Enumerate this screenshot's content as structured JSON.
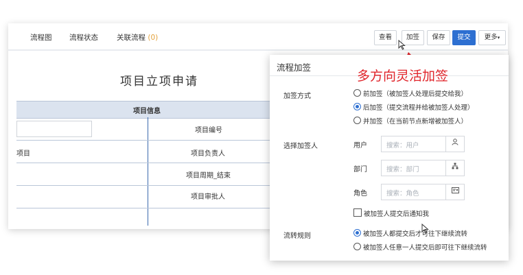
{
  "toolbar": {
    "tabs": [
      "流程图",
      "流程状态",
      "关联流程"
    ],
    "related_count": "(0)",
    "buttons": {
      "view": "查看",
      "add_sign": "加签",
      "save": "保存",
      "submit": "提交",
      "more": "更多"
    }
  },
  "form": {
    "title": "项目立项申请",
    "section": "项目信息",
    "rows": [
      {
        "left": "",
        "right": "项目编号"
      },
      {
        "left": "项目",
        "right": "项目负责人"
      },
      {
        "left": "",
        "right": "项目周期_结束"
      },
      {
        "left": "",
        "right": "项目审批人"
      }
    ]
  },
  "dialog": {
    "title": "流程加签",
    "method_label": "加签方式",
    "method_options": [
      "前加签（被加签人处理后提交给我）",
      "后加签（提交流程并给被加签人处理）",
      "并加签（在当前节点新增被加签人）"
    ],
    "method_selected": 1,
    "select_label": "选择加签人",
    "fields": [
      {
        "label": "用户",
        "placeholder": "搜索：用户",
        "icon": "user-icon"
      },
      {
        "label": "部门",
        "placeholder": "搜索：部门",
        "icon": "org-chart-icon"
      },
      {
        "label": "角色",
        "placeholder": "搜索：角色",
        "icon": "role-card-icon"
      }
    ],
    "notify_label": "被加签人提交后通知我",
    "rule_label": "流转规则",
    "rule_options": [
      "被加签人都提交后才可往下继续流转",
      "被加签人任意一人提交后即可往下继续流转"
    ],
    "rule_selected": 0
  },
  "annotation": {
    "text": "多方向灵活加签",
    "color": "#e0242a"
  },
  "colors": {
    "primary": "#2d6fd1",
    "section_bg": "#dbe3ef"
  }
}
